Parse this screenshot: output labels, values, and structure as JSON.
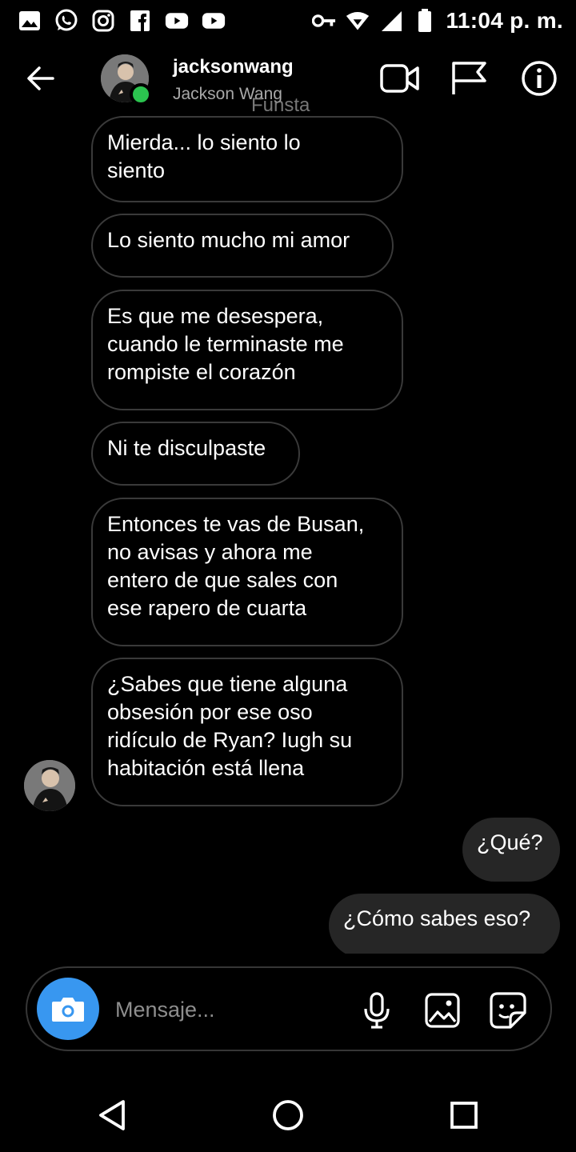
{
  "status_bar": {
    "time": "11:04 p. m.",
    "left_icons": [
      "gallery-icon",
      "whatsapp-icon",
      "instagram-icon",
      "facebook-icon",
      "youtube-icon",
      "youtube-icon"
    ],
    "right_icons": [
      "key-icon",
      "wifi-icon",
      "signal-icon",
      "battery-icon"
    ]
  },
  "header": {
    "username": "jacksonwang",
    "full_name": "Jackson Wang",
    "overlay_text": "Funsta",
    "online": true,
    "online_color": "#2bc44f"
  },
  "messages": [
    {
      "direction": "in",
      "text_lines": [
        "Mierda... lo siento lo",
        "siento"
      ]
    },
    {
      "direction": "in",
      "text_lines": [
        "Lo siento mucho mi amor"
      ]
    },
    {
      "direction": "in",
      "text_lines": [
        "Es que me desespera,",
        "cuando le terminaste me",
        "rompiste el corazón"
      ]
    },
    {
      "direction": "in",
      "text_lines": [
        "Ni te disculpaste"
      ]
    },
    {
      "direction": "in",
      "text_lines": [
        "Entonces te vas de Busan,",
        "no avisas y ahora me",
        "entero de que sales con",
        "ese rapero de cuarta"
      ]
    },
    {
      "direction": "in",
      "text_lines": [
        "¿Sabes que tiene alguna",
        "obsesión por ese oso",
        "ridículo de Ryan? Iugh su",
        "habitación está llena"
      ]
    },
    {
      "direction": "out",
      "text_lines": [
        "¿Qué?"
      ]
    },
    {
      "direction": "out",
      "text_lines": [
        "¿Cómo sabes eso?"
      ]
    }
  ],
  "composer": {
    "placeholder": "Mensaje...",
    "camera_color": "#3897f0"
  },
  "colors": {
    "background": "#000000",
    "incoming_border": "#3a3a3a",
    "outgoing_bg": "#262626"
  }
}
